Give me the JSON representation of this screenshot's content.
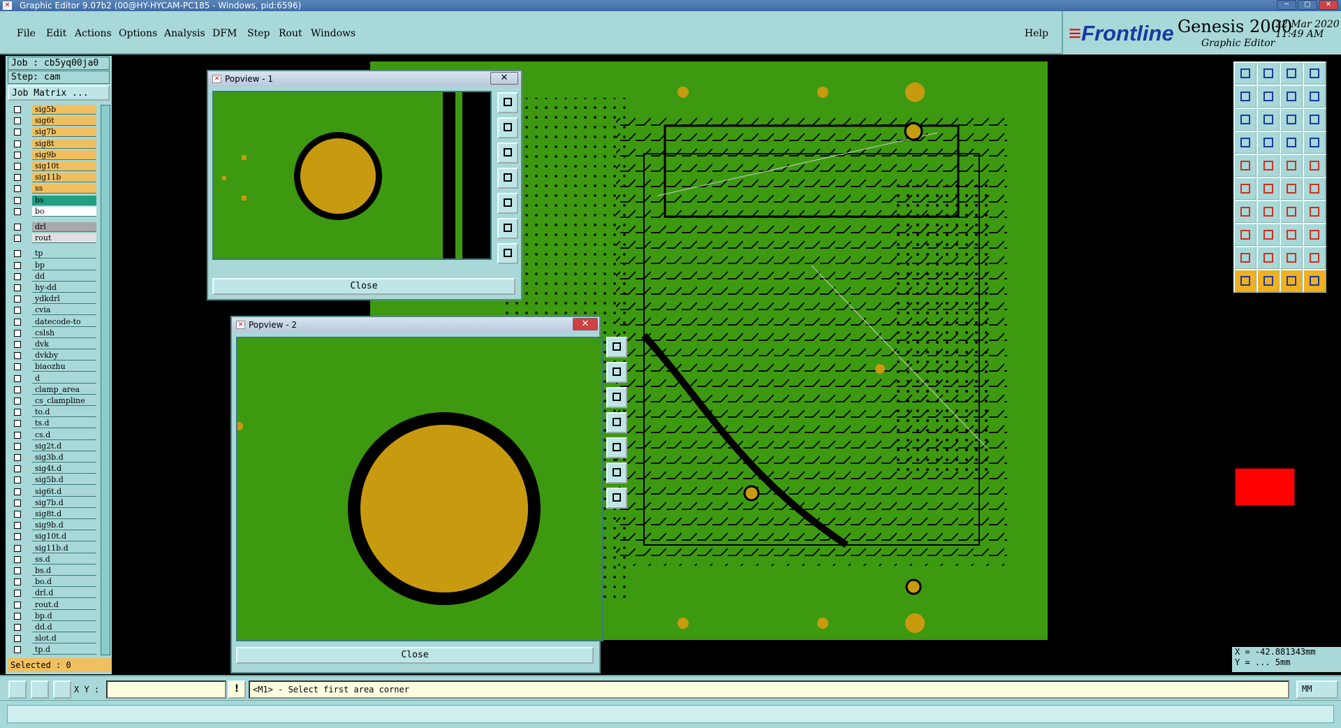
{
  "window": {
    "title": "Graphic Editor 9.07b2 (00@HY-HYCAM-PC185 - Windows, pid:6596)"
  },
  "menu": {
    "items": [
      "File",
      "Edit",
      "Actions",
      "Options",
      "Analysis",
      "DFM",
      "Step",
      "Rout",
      "Windows"
    ],
    "help": "Help"
  },
  "brand": {
    "logo": "Frontline",
    "product": "Genesis 2000",
    "subtitle": "Graphic Editor",
    "date": "22 Mar 2020",
    "time": "11:49 AM"
  },
  "job": {
    "job_label": "Job : cb5yq00ja0",
    "step_label": "Step: cam",
    "matrix_button": "Job Matrix ..."
  },
  "layers": [
    {
      "name": "sig5b",
      "color": "#f0c060"
    },
    {
      "name": "sig6t",
      "color": "#f0c060"
    },
    {
      "name": "sig7b",
      "color": "#f0c060"
    },
    {
      "name": "sig8t",
      "color": "#f0c060"
    },
    {
      "name": "sig9b",
      "color": "#f0c060"
    },
    {
      "name": "sig10t",
      "color": "#f0c060"
    },
    {
      "name": "sig11b",
      "color": "#f0c060"
    },
    {
      "name": "ss",
      "color": "#f0c060"
    },
    {
      "name": "bs",
      "color": "#20a080"
    },
    {
      "name": "bo",
      "color": "#ffffff"
    },
    {
      "name": "drl",
      "color": "#a8a8a8"
    },
    {
      "name": "rout",
      "color": "#e0e0e0"
    },
    {
      "name": "tp",
      "color": "#a8d8d8"
    },
    {
      "name": "bp",
      "color": "#a8d8d8"
    },
    {
      "name": "dd",
      "color": "#a8d8d8"
    },
    {
      "name": "hy-dd",
      "color": "#a8d8d8"
    },
    {
      "name": "ydkdrl",
      "color": "#a8d8d8"
    },
    {
      "name": "cvia",
      "color": "#a8d8d8"
    },
    {
      "name": "datecode-to",
      "color": "#a8d8d8"
    },
    {
      "name": "cslsh",
      "color": "#a8d8d8"
    },
    {
      "name": "dvk",
      "color": "#a8d8d8"
    },
    {
      "name": "dvkby",
      "color": "#a8d8d8"
    },
    {
      "name": "biaozhu",
      "color": "#a8d8d8"
    },
    {
      "name": "d",
      "color": "#a8d8d8"
    },
    {
      "name": "clamp_area",
      "color": "#a8d8d8"
    },
    {
      "name": "cs_clampline",
      "color": "#a8d8d8"
    },
    {
      "name": "to.d",
      "color": "#a8d8d8"
    },
    {
      "name": "ts.d",
      "color": "#a8d8d8"
    },
    {
      "name": "cs.d",
      "color": "#a8d8d8"
    },
    {
      "name": "sig2t.d",
      "color": "#a8d8d8"
    },
    {
      "name": "sig3b.d",
      "color": "#a8d8d8"
    },
    {
      "name": "sig4t.d",
      "color": "#a8d8d8"
    },
    {
      "name": "sig5b.d",
      "color": "#a8d8d8"
    },
    {
      "name": "sig6t.d",
      "color": "#a8d8d8"
    },
    {
      "name": "sig7b.d",
      "color": "#a8d8d8"
    },
    {
      "name": "sig8t.d",
      "color": "#a8d8d8"
    },
    {
      "name": "sig9b.d",
      "color": "#a8d8d8"
    },
    {
      "name": "sig10t.d",
      "color": "#a8d8d8"
    },
    {
      "name": "sig11b.d",
      "color": "#a8d8d8"
    },
    {
      "name": "ss.d",
      "color": "#a8d8d8"
    },
    {
      "name": "bs.d",
      "color": "#a8d8d8"
    },
    {
      "name": "bo.d",
      "color": "#a8d8d8"
    },
    {
      "name": "drl.d",
      "color": "#a8d8d8"
    },
    {
      "name": "rout.d",
      "color": "#a8d8d8"
    },
    {
      "name": "bp.d",
      "color": "#a8d8d8"
    },
    {
      "name": "dd.d",
      "color": "#a8d8d8"
    },
    {
      "name": "slot.d",
      "color": "#a8d8d8"
    },
    {
      "name": "tp.d",
      "color": "#a8d8d8"
    }
  ],
  "selected_label": "Selected : 0",
  "popview1": {
    "title": "Popview - 1",
    "close": "Close"
  },
  "popview2": {
    "title": "Popview - 2",
    "close": "Close"
  },
  "coords": {
    "x": "X = -42.881343mm",
    "y": "Y = ... 5mm"
  },
  "status": {
    "xy_label": "X Y :",
    "xy_value": "",
    "message": "<M1> - Select first area corner",
    "units": "MM"
  },
  "colors": {
    "board": "#3d9a10",
    "pad": "#c89a10",
    "panel": "#a8d8d8"
  }
}
